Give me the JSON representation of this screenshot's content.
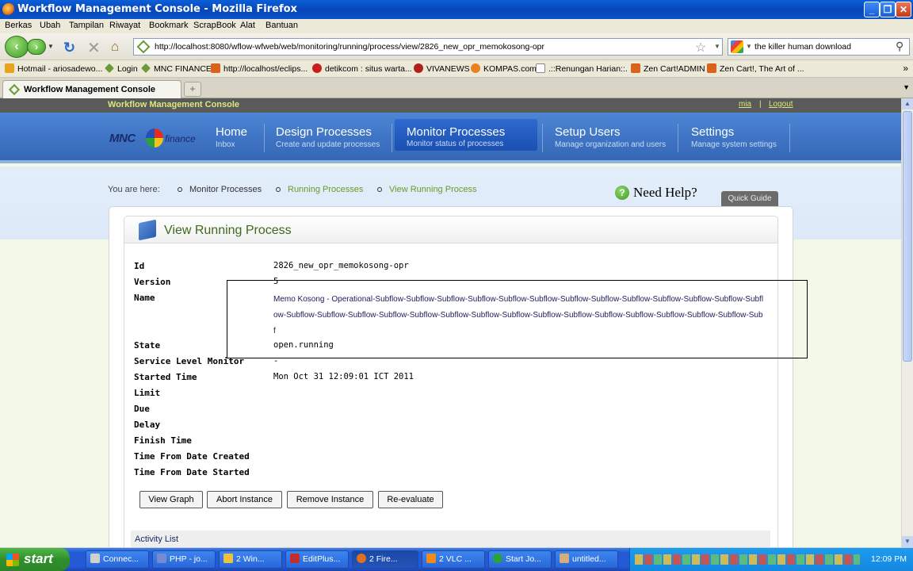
{
  "window": {
    "title": "Workflow Management Console - Mozilla Firefox",
    "controls": [
      "_",
      "❐",
      "✕"
    ]
  },
  "menubar": [
    "Berkas",
    "Ubah",
    "Tampilan",
    "Riwayat",
    "Bookmark",
    "ScrapBook",
    "Alat",
    "Bantuan"
  ],
  "navbar": {
    "url": "http://localhost:8080/wflow-wfweb/web/monitoring/running/process/view/2826_new_opr_memokosong-opr",
    "search_value": "the killer human download"
  },
  "bookmarks": [
    {
      "label": "Hotmail - ariosadewo...",
      "color": "#e9a21e"
    },
    {
      "label": "Login",
      "color": "#6a9a3a"
    },
    {
      "label": "MNC FINANCE",
      "color": "#6a9a3a"
    },
    {
      "label": "http://localhost/eclips...",
      "color": "#d8621e"
    },
    {
      "label": "detikcom : situs warta...",
      "color": "#c81e1e"
    },
    {
      "label": "VIVANEWS",
      "color": "#b01e1e"
    },
    {
      "label": "KOMPAS.com",
      "color": "#e9821e"
    },
    {
      "label": ".::Renungan Harian::.",
      "color": "#ffffff"
    },
    {
      "label": "Zen Cart!ADMIN",
      "color": "#d8621e"
    },
    {
      "label": "Zen Cart!, The Art of ...",
      "color": "#d8621e"
    }
  ],
  "tab": {
    "label": "Workflow Management Console"
  },
  "app": {
    "name": "Workflow Management Console",
    "user": "mia",
    "separator": "|",
    "logout": "Logout"
  },
  "menu": [
    {
      "label": "Home",
      "sub": "Inbox"
    },
    {
      "label": "Design Processes",
      "sub": "Create and update processes"
    },
    {
      "label": "Monitor Processes",
      "sub": "Monitor status of processes"
    },
    {
      "label": "Setup Users",
      "sub": "Manage organization and users"
    },
    {
      "label": "Settings",
      "sub": "Manage system settings"
    }
  ],
  "logo": {
    "left": "MNC",
    "right": "finance"
  },
  "breadcrumb": {
    "prefix": "You are here:",
    "items": [
      "Monitor Processes",
      "Running Processes",
      "View Running Process"
    ]
  },
  "help": {
    "label": "Need Help?",
    "quick_guide": "Quick Guide"
  },
  "page": {
    "title": "View Running Process"
  },
  "details": [
    {
      "key": "Id",
      "value": "2826_new_opr_memokosong-opr"
    },
    {
      "key": "Version",
      "value": "5"
    },
    {
      "key": "Name",
      "value": ""
    },
    {
      "key": "",
      "value": ""
    },
    {
      "key": "",
      "value": ""
    },
    {
      "key": "State",
      "value": "open.running"
    },
    {
      "key": "Service Level Monitor",
      "value": "-"
    },
    {
      "key": "Started Time",
      "value": "Mon Oct 31 12:09:01 ICT 2011"
    },
    {
      "key": "Limit",
      "value": ""
    },
    {
      "key": "Due",
      "value": ""
    },
    {
      "key": "Delay",
      "value": ""
    },
    {
      "key": "Finish Time",
      "value": ""
    },
    {
      "key": "Time From Date Created",
      "value": ""
    },
    {
      "key": "Time From Date Started",
      "value": ""
    }
  ],
  "process_name": "Memo Kosong - Operational-Subflow-Subflow-Subflow-Subflow-Subflow-Subflow-Subflow-Subflow-Subflow-Subflow-Subflow-Subflow-Subflow-Subflow-Subflow-Subflow-Subflow-Subflow-Subflow-Subflow-Subflow-Subflow-Subflow-Subflow-Subflow-Subflow-Subflow-Subflow-Subf",
  "actions": [
    "View Graph",
    "Abort Instance",
    "Remove Instance",
    "Re-evaluate"
  ],
  "activity_list": "Activity List",
  "taskbar": {
    "start": "start",
    "buttons": [
      {
        "label": "Connec...",
        "color": "#d0d0d0"
      },
      {
        "label": "PHP - jo...",
        "color": "#7a8ad0"
      },
      {
        "label": "2 Win...",
        "color": "#f0c040"
      },
      {
        "label": "EditPlus...",
        "color": "#c03030"
      },
      {
        "label": "2 Fire...",
        "color": "#e07020"
      },
      {
        "label": "2 VLC ...",
        "color": "#f08a1e"
      },
      {
        "label": "Start Jo...",
        "color": "#2aa23a"
      },
      {
        "label": "untitled...",
        "color": "#d0b080"
      }
    ],
    "clock": "12:09 PM"
  }
}
